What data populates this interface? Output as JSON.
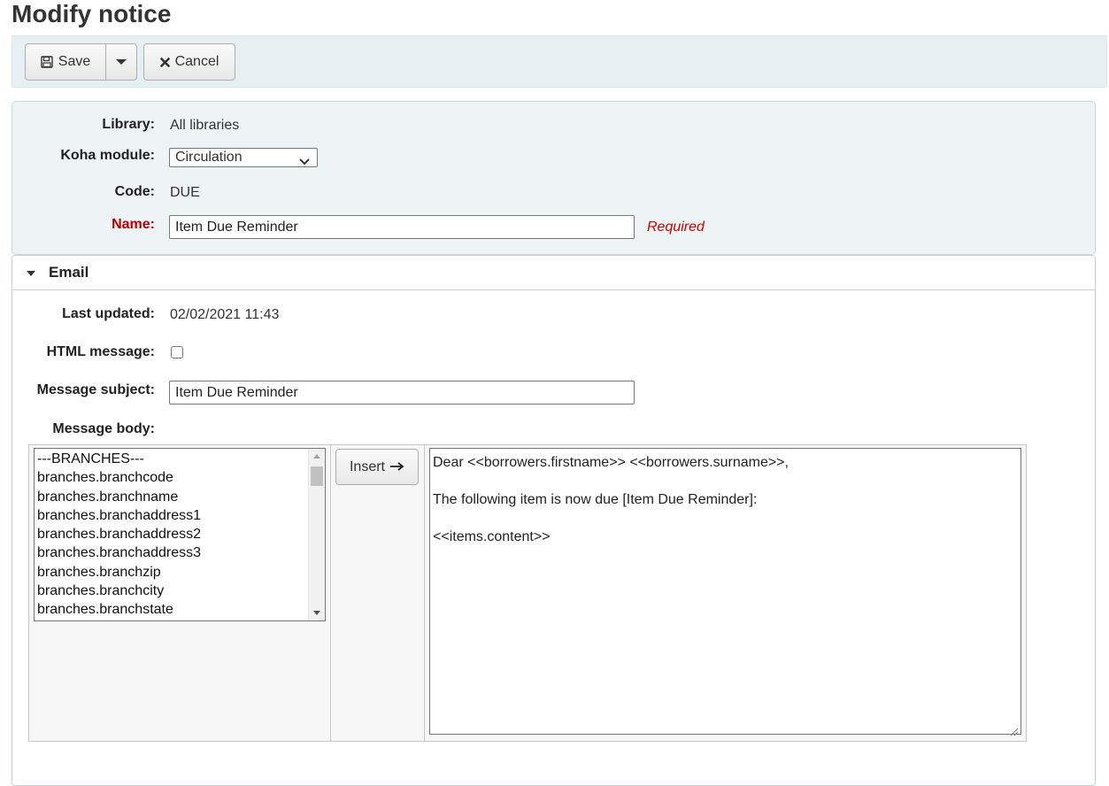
{
  "page": {
    "title": "Modify notice"
  },
  "toolbar": {
    "save_label": "Save",
    "cancel_label": "Cancel"
  },
  "form": {
    "library_label": "Library:",
    "library_value": "All libraries",
    "module_label": "Koha module:",
    "module_value": "Circulation",
    "code_label": "Code:",
    "code_value": "DUE",
    "name_label": "Name:",
    "name_value": "Item Due Reminder",
    "required_text": "Required"
  },
  "email": {
    "section_title": "Email",
    "last_updated_label": "Last updated:",
    "last_updated_value": "02/02/2021 11:43",
    "html_message_label": "HTML message:",
    "html_message_checked": false,
    "subject_label": "Message subject:",
    "subject_value": "Item Due Reminder",
    "body_label": "Message body:",
    "fields_list": [
      "---BRANCHES---",
      "branches.branchcode",
      "branches.branchname",
      "branches.branchaddress1",
      "branches.branchaddress2",
      "branches.branchaddress3",
      "branches.branchzip",
      "branches.branchcity",
      "branches.branchstate"
    ],
    "insert_label": "Insert",
    "body_lines": [
      "Dear <<borrowers.firstname>> <<borrowers.surname>>,",
      "",
      "The following item is now due [Item Due Reminder]:",
      "",
      "<<items.content>>"
    ]
  }
}
